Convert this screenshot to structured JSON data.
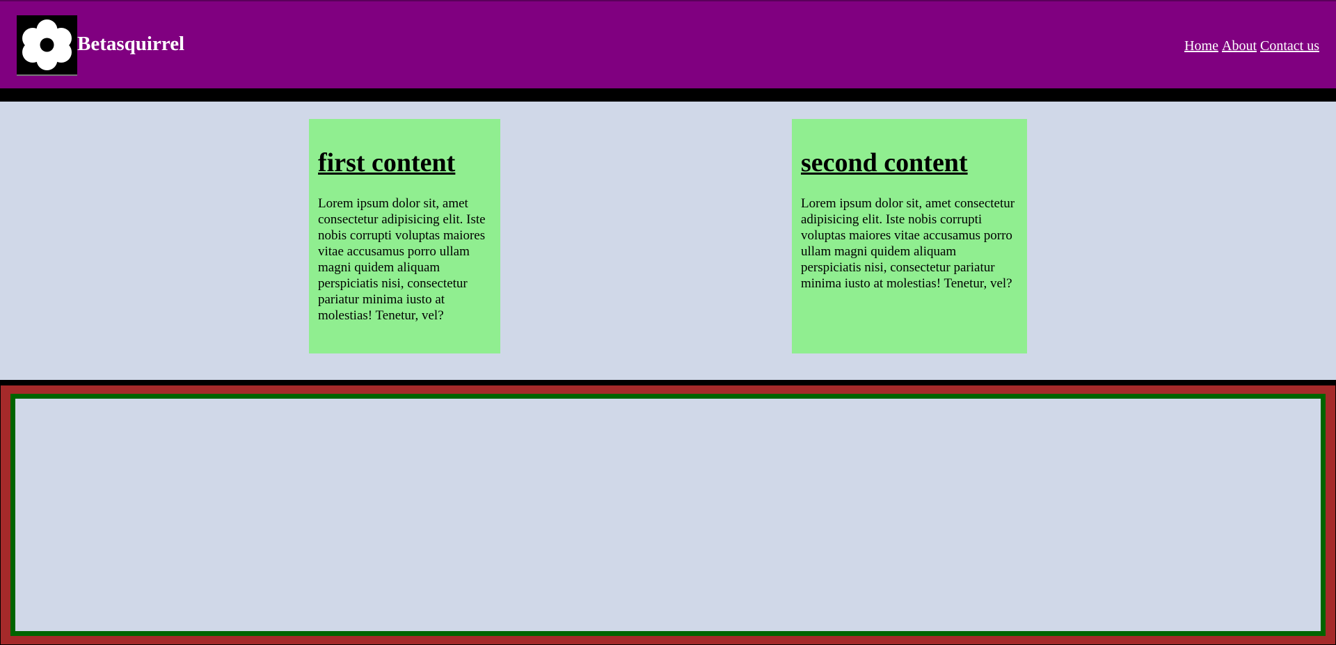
{
  "header": {
    "brand": "Betasquirrel",
    "logo_icon": "flower-icon",
    "background": "#800080",
    "nav": [
      {
        "label": "Home"
      },
      {
        "label": "About"
      },
      {
        "label": "Contact us"
      }
    ]
  },
  "cards": [
    {
      "title": "first content",
      "body": "Lorem ipsum dolor sit, amet consectetur adipisicing elit. Iste nobis corrupti voluptas maiores vitae accusamus porro ullam magni quidem aliquam perspiciatis nisi, consectetur pariatur minima iusto at molestias! Tenetur, vel?"
    },
    {
      "title": "second content",
      "body": "Lorem ipsum dolor sit, amet consectetur adipisicing elit. Iste nobis corrupti voluptas maiores vitae accusamus porro ullam magni quidem aliquam perspiciatis nisi, consectetur pariatur minima iusto at molestias! Tenetur, vel?"
    }
  ],
  "colors": {
    "page_background": "#d0d8e8",
    "card_background": "#90ee90",
    "footer_outer": "#a52a2a",
    "footer_border": "#006400"
  }
}
